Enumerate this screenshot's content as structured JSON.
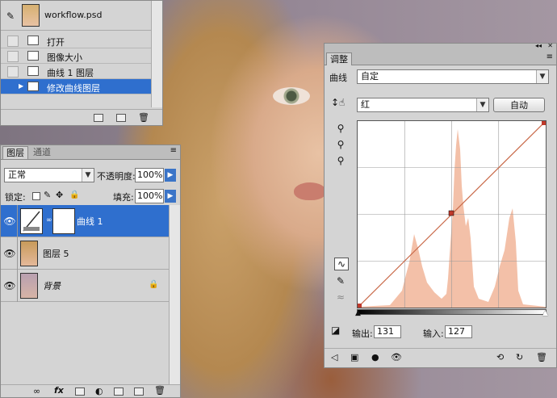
{
  "history": {
    "doc_name": "workflow.psd",
    "items": [
      {
        "label": "打开",
        "selected": false
      },
      {
        "label": "图像大小",
        "selected": false
      },
      {
        "label": "曲线 1 图层",
        "selected": false
      },
      {
        "label": "修改曲线图层",
        "selected": true
      }
    ]
  },
  "layers": {
    "tabs": [
      "图层",
      "通道"
    ],
    "blend_mode": "正常",
    "opacity_label": "不透明度:",
    "opacity_value": "100%",
    "lock_label": "锁定:",
    "fill_label": "填充:",
    "fill_value": "100%",
    "rows": [
      {
        "name": "曲线 1",
        "selected": true
      },
      {
        "name": "图层 5",
        "selected": false
      },
      {
        "name": "背景",
        "selected": false
      }
    ]
  },
  "adjust": {
    "tab": "调整",
    "preset_label": "曲线",
    "preset_value": "自定",
    "channel_value": "红",
    "auto_label": "自动",
    "output_label": "输出:",
    "output_value": "131",
    "input_label": "输入:",
    "input_value": "127"
  },
  "colors": {
    "selection": "#2f6fce",
    "curve": "#c96a4a",
    "histogram": "#f3c0a8"
  }
}
